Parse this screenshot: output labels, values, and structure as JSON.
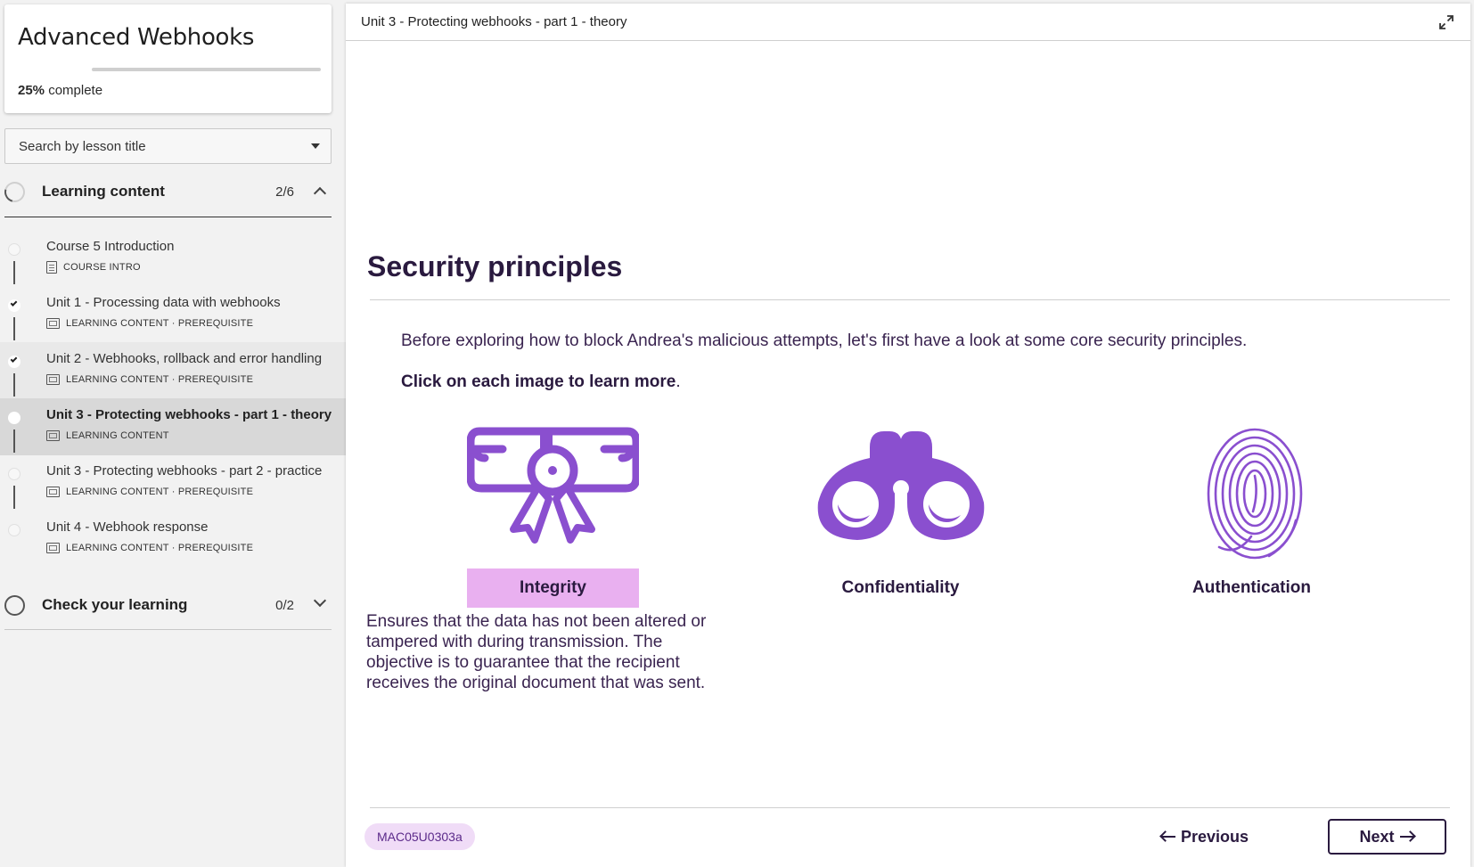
{
  "course": {
    "title": "Advanced Webhooks",
    "progress_value": "25%",
    "progress_suffix": "complete",
    "progress_fraction": 0.0
  },
  "search": {
    "placeholder": "Search by lesson title"
  },
  "sections": [
    {
      "label": "Learning content",
      "count": "2/6",
      "expanded": true
    },
    {
      "label": "Check your learning",
      "count": "0/2",
      "expanded": false
    }
  ],
  "lessons": [
    {
      "title": "Course 5 Introduction",
      "meta": "COURSE INTRO",
      "status": "not-started",
      "icon": "document-icon"
    },
    {
      "title": "Unit 1 - Processing data with webhooks",
      "meta": "LEARNING CONTENT · PREREQUISITE",
      "status": "completed",
      "icon": "slides-icon"
    },
    {
      "title": "Unit 2 - Webhooks, rollback and error handling",
      "meta": "LEARNING CONTENT · PREREQUISITE",
      "status": "completed",
      "icon": "slides-icon"
    },
    {
      "title": "Unit 3 - Protecting webhooks - part 1 - theory",
      "meta": "LEARNING CONTENT",
      "status": "current",
      "icon": "slides-icon"
    },
    {
      "title": "Unit 3 - Protecting webhooks - part 2 - practice",
      "meta": "LEARNING CONTENT · PREREQUISITE",
      "status": "not-started",
      "icon": "slides-icon"
    },
    {
      "title": "Unit 4 - Webhook response",
      "meta": "LEARNING CONTENT · PREREQUISITE",
      "status": "not-started",
      "icon": "slides-icon"
    }
  ],
  "main": {
    "breadcrumb": "Unit 3 - Protecting webhooks - part 1 - theory",
    "heading": "Security principles",
    "intro": "Before exploring how to block Andrea's malicious attempts, let's first have a look at some core security principles.",
    "cta_bold": "Click on each image to learn more",
    "cta_tail": ".",
    "cards": [
      {
        "label": "Integrity",
        "icon": "certificate-icon",
        "selected": true
      },
      {
        "label": "Confidentiality",
        "icon": "binoculars-icon",
        "selected": false
      },
      {
        "label": "Authentication",
        "icon": "fingerprint-icon",
        "selected": false
      }
    ],
    "description": "Ensures that the data has not been altered or tampered with during transmission. The objective is to guarantee that the recipient receives the original document that was sent.",
    "ref_code": "MAC05U0303a",
    "prev_label": "Previous",
    "next_label": "Next"
  },
  "colors": {
    "accent_purple": "#8a4fcf",
    "selected_highlight": "#e9b0f0",
    "heading_ink": "#2a1a3f"
  }
}
